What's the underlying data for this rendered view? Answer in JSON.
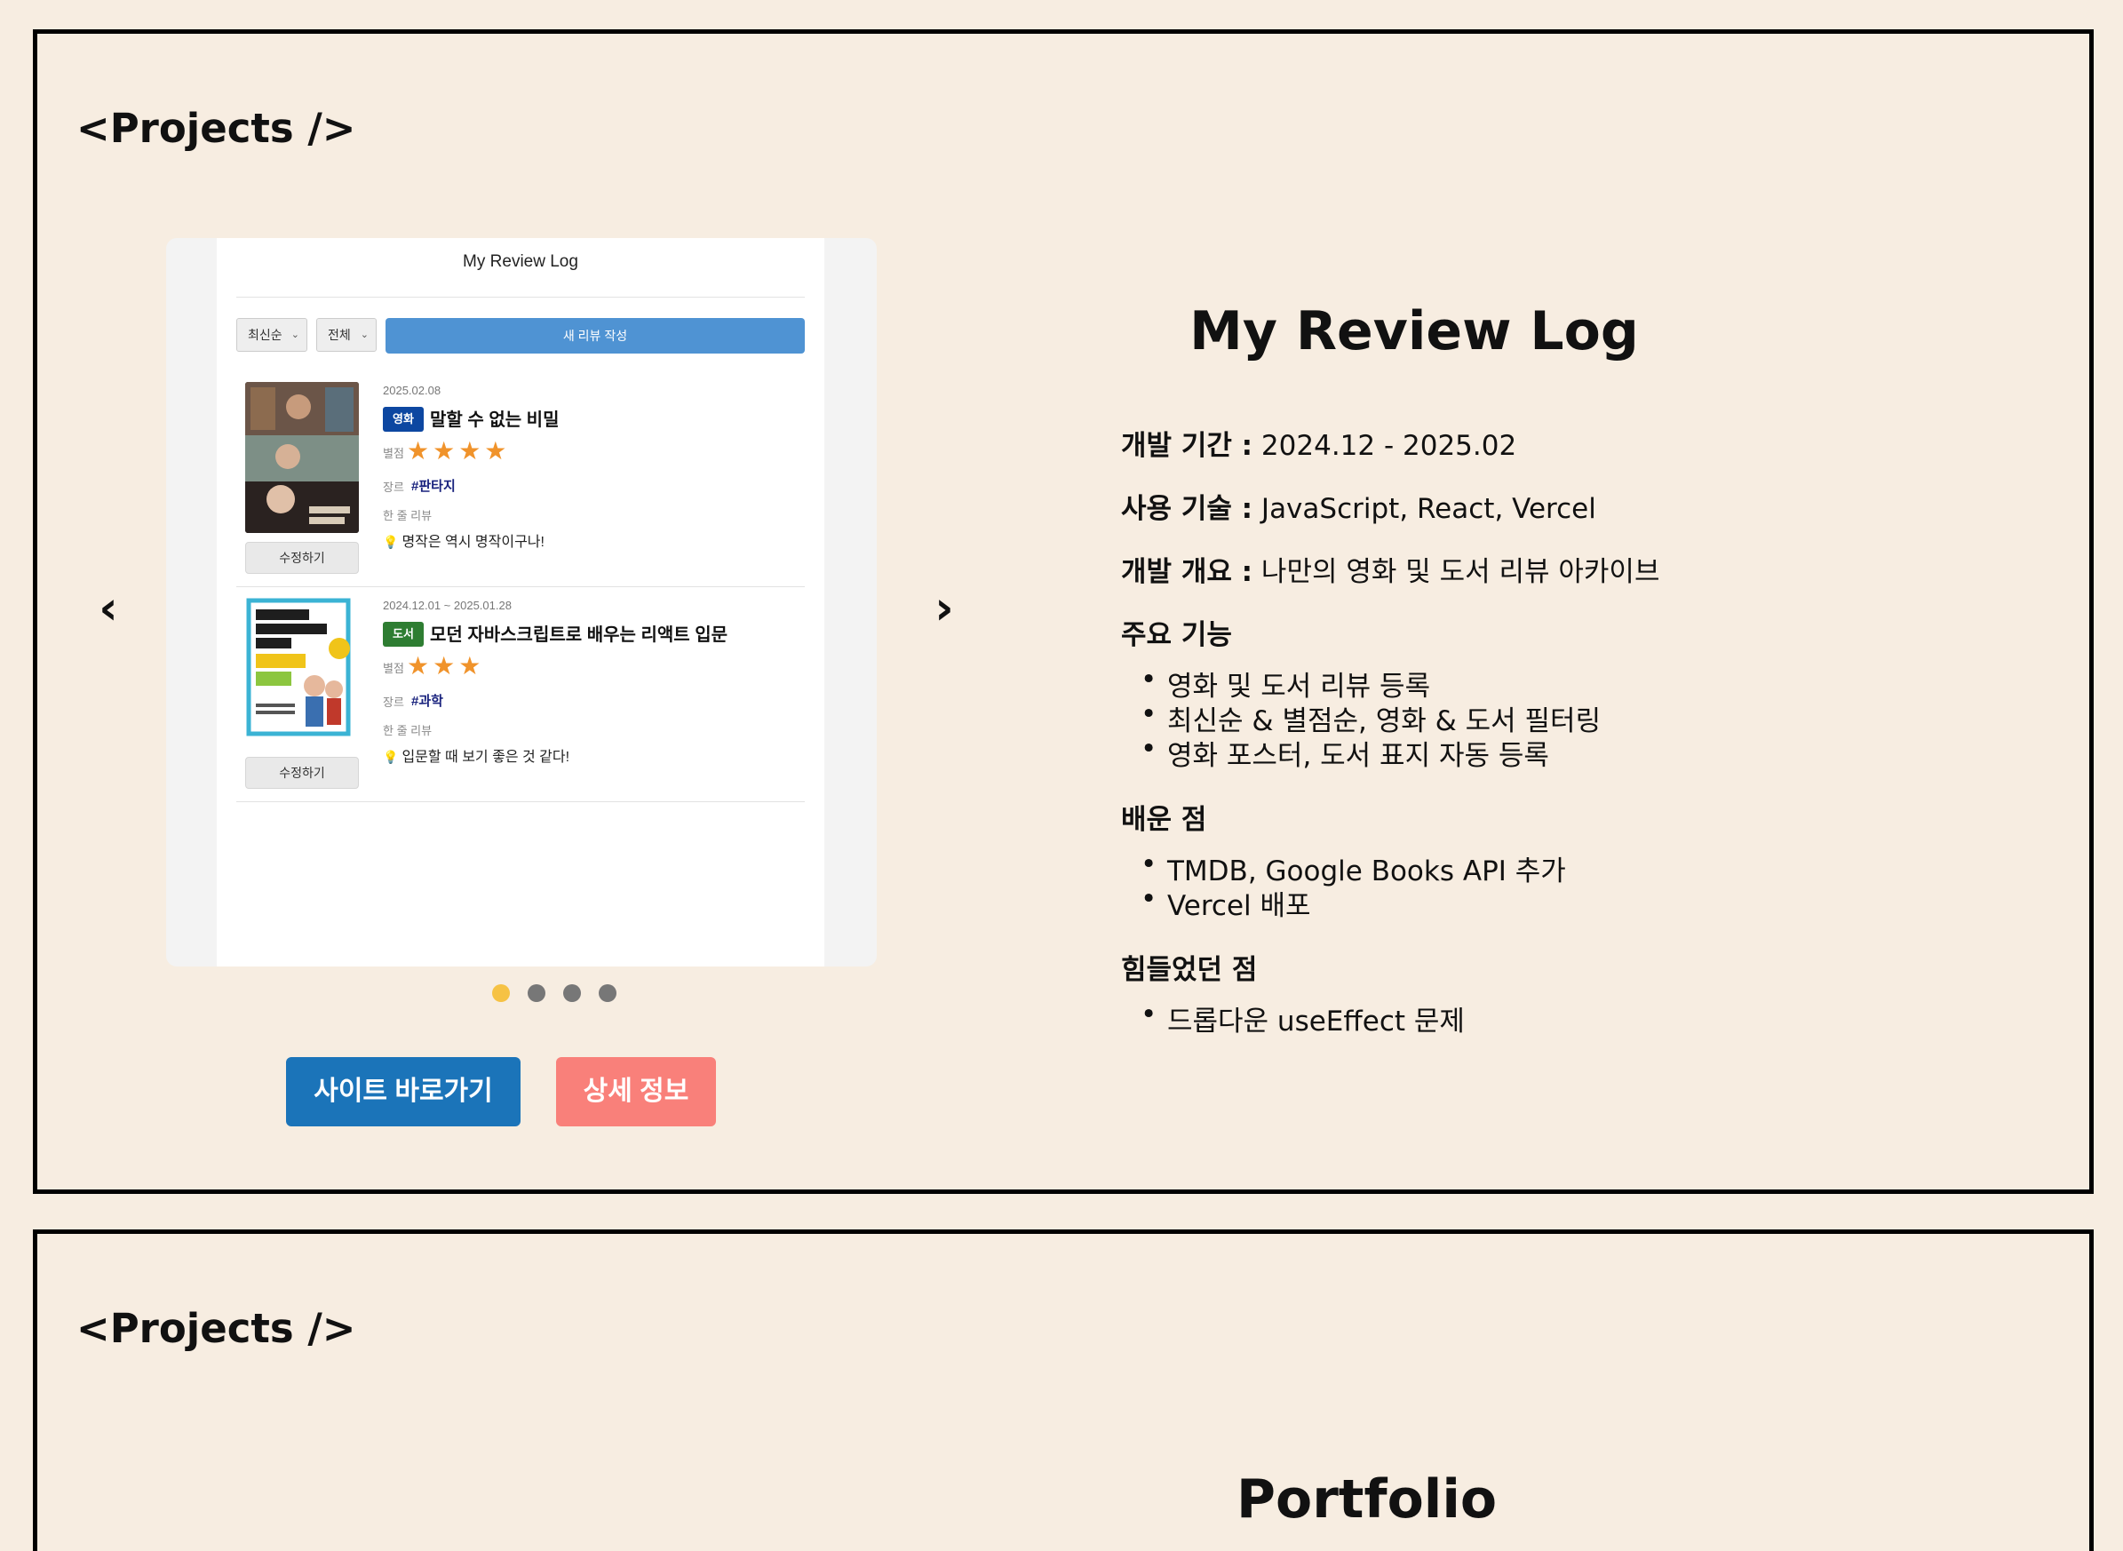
{
  "sections": [
    {
      "heading": "<Projects />",
      "carousel": {
        "prev_icon": "‹",
        "next_icon": "›",
        "dots_total": 4,
        "active_dot": 1,
        "screenshot": {
          "app_title": "My Review Log",
          "sort_select": "최신순",
          "filter_select": "전체",
          "new_review_button": "새 리뷰 작성",
          "reviews": [
            {
              "date": "2025.02.08",
              "badge": "영화",
              "badge_color": "#0d47a1",
              "title": "말할 수 없는 비밀",
              "rating_label": "별점",
              "stars": "★★★★",
              "rating": 4,
              "genre_label": "장르",
              "genre": "#판타지",
              "oneline_label": "한 줄 리뷰",
              "oneline": "명작은 역시 명작이구나!",
              "edit_button": "수정하기"
            },
            {
              "date": "2024.12.01 ~ 2025.01.28",
              "badge": "도서",
              "badge_color": "#2e7d32",
              "title": "모던 자바스크립트로 배우는 리액트 입문",
              "rating_label": "별점",
              "stars": "★★★",
              "rating": 3,
              "genre_label": "장르",
              "genre": "#과학",
              "oneline_label": "한 줄 리뷰",
              "oneline": "입문할 때 보기 좋은 것 같다!",
              "edit_button": "수정하기"
            }
          ]
        }
      },
      "buttons": {
        "site": "사이트 바로가기",
        "detail": "상세 정보"
      },
      "project": {
        "title": "My Review Log",
        "period_label": "개발 기간 :",
        "period": "2024.12 - 2025.02",
        "tech_label": "사용 기술 :",
        "tech": "JavaScript, React, Vercel",
        "overview_label": "개발 개요 :",
        "overview": "나만의 영화 및 도서 리뷰 아카이브",
        "features_heading": "주요 기능",
        "features": [
          "영화 및 도서 리뷰 등록",
          "최신순 & 별점순, 영화 & 도서 필터링",
          "영화 포스터, 도서 표지 자동 등록"
        ],
        "learned_heading": "배운 점",
        "learned": [
          "TMDB, Google Books API 추가",
          "Vercel 배포"
        ],
        "difficulties_heading": "힘들었던 점",
        "difficulties": [
          "드롭다운 useEffect 문제"
        ]
      }
    },
    {
      "heading": "<Projects />",
      "project": {
        "title": "Portfolio"
      }
    }
  ],
  "colors": {
    "background": "#f7ede1",
    "site_button": "#1b74b9",
    "detail_button": "#f9807a",
    "active_dot": "#f6c244",
    "star": "#f0932b",
    "new_review_button": "#4f93d3"
  }
}
